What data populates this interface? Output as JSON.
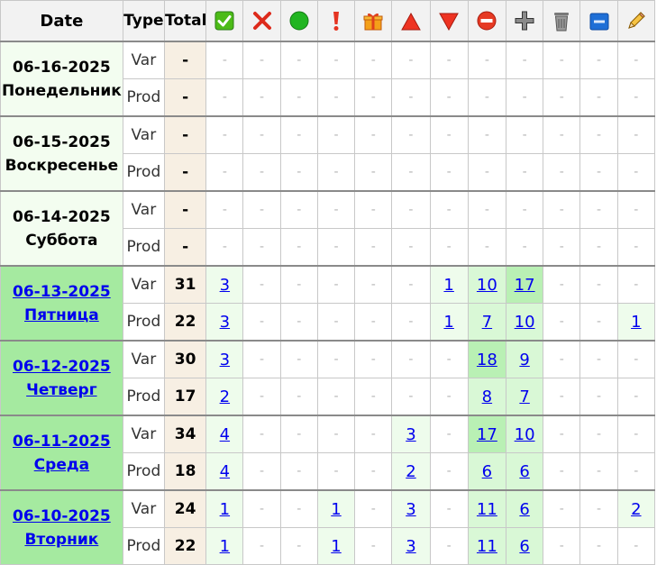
{
  "header": {
    "date": "Date",
    "type": "Type",
    "total": "Total",
    "icons": [
      "check-icon",
      "x-icon",
      "green-circle-icon",
      "exclamation-icon",
      "gift-icon",
      "triangle-up-icon",
      "triangle-down-icon",
      "no-entry-icon",
      "plus-icon",
      "trash-icon",
      "new-badge-icon",
      "pencil-icon"
    ]
  },
  "placeholder": "-",
  "groups": [
    {
      "date": "06-16-2025",
      "day": "Понедельник",
      "active": false,
      "rows": [
        {
          "type": "Var",
          "total": "-",
          "cells": [
            "",
            "",
            "",
            "",
            "",
            "",
            "",
            "",
            "",
            "",
            "",
            ""
          ]
        },
        {
          "type": "Prod",
          "total": "-",
          "cells": [
            "",
            "",
            "",
            "",
            "",
            "",
            "",
            "",
            "",
            "",
            "",
            ""
          ]
        }
      ]
    },
    {
      "date": "06-15-2025",
      "day": "Воскресенье",
      "active": false,
      "rows": [
        {
          "type": "Var",
          "total": "-",
          "cells": [
            "",
            "",
            "",
            "",
            "",
            "",
            "",
            "",
            "",
            "",
            "",
            ""
          ]
        },
        {
          "type": "Prod",
          "total": "-",
          "cells": [
            "",
            "",
            "",
            "",
            "",
            "",
            "",
            "",
            "",
            "",
            "",
            ""
          ]
        }
      ]
    },
    {
      "date": "06-14-2025",
      "day": "Суббота",
      "active": false,
      "rows": [
        {
          "type": "Var",
          "total": "-",
          "cells": [
            "",
            "",
            "",
            "",
            "",
            "",
            "",
            "",
            "",
            "",
            "",
            ""
          ]
        },
        {
          "type": "Prod",
          "total": "-",
          "cells": [
            "",
            "",
            "",
            "",
            "",
            "",
            "",
            "",
            "",
            "",
            "",
            ""
          ]
        }
      ]
    },
    {
      "date": "06-13-2025",
      "day": "Пятница",
      "active": true,
      "rows": [
        {
          "type": "Var",
          "total": "31",
          "cells": [
            "3",
            "",
            "",
            "",
            "",
            "",
            "1",
            "10",
            "17",
            "",
            "",
            ""
          ]
        },
        {
          "type": "Prod",
          "total": "22",
          "cells": [
            "3",
            "",
            "",
            "",
            "",
            "",
            "1",
            "7",
            "10",
            "",
            "",
            "1"
          ]
        }
      ]
    },
    {
      "date": "06-12-2025",
      "day": "Четверг",
      "active": true,
      "rows": [
        {
          "type": "Var",
          "total": "30",
          "cells": [
            "3",
            "",
            "",
            "",
            "",
            "",
            "",
            "18",
            "9",
            "",
            "",
            ""
          ]
        },
        {
          "type": "Prod",
          "total": "17",
          "cells": [
            "2",
            "",
            "",
            "",
            "",
            "",
            "",
            "8",
            "7",
            "",
            "",
            ""
          ]
        }
      ]
    },
    {
      "date": "06-11-2025",
      "day": "Среда",
      "active": true,
      "rows": [
        {
          "type": "Var",
          "total": "34",
          "cells": [
            "4",
            "",
            "",
            "",
            "",
            "3",
            "",
            "17",
            "10",
            "",
            "",
            ""
          ]
        },
        {
          "type": "Prod",
          "total": "18",
          "cells": [
            "4",
            "",
            "",
            "",
            "",
            "2",
            "",
            "6",
            "6",
            "",
            "",
            ""
          ]
        }
      ]
    },
    {
      "date": "06-10-2025",
      "day": "Вторник",
      "active": true,
      "rows": [
        {
          "type": "Var",
          "total": "24",
          "cells": [
            "1",
            "",
            "",
            "1",
            "",
            "3",
            "",
            "11",
            "6",
            "",
            "",
            "2"
          ]
        },
        {
          "type": "Prod",
          "total": "22",
          "cells": [
            "1",
            "",
            "",
            "1",
            "",
            "3",
            "",
            "11",
            "6",
            "",
            "",
            ""
          ]
        }
      ]
    }
  ],
  "colors": {
    "link": "#0000ee",
    "active_date_bg": "#a5eaa0",
    "empty_date_bg": "#f3fdf0",
    "total_bg": "#f7efe3",
    "header_bg": "#f2f2f2"
  }
}
